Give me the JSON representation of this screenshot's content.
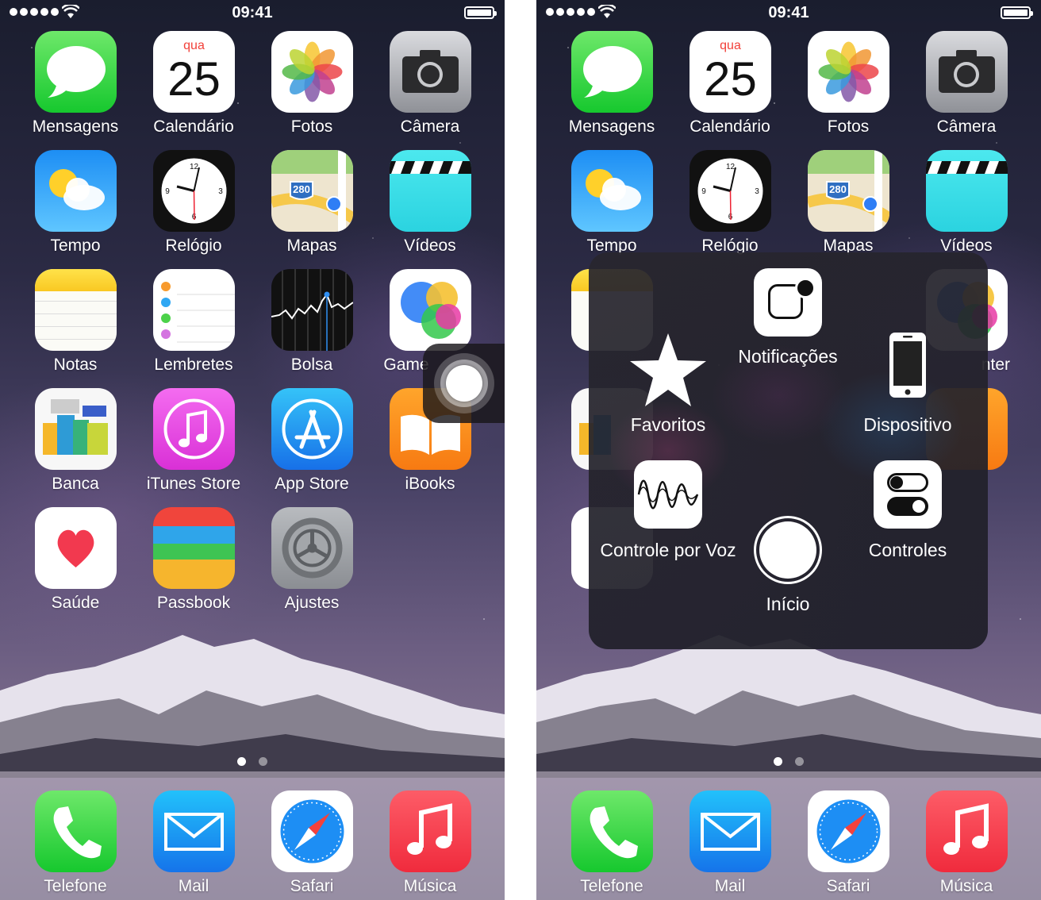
{
  "status_bar": {
    "time": "09:41"
  },
  "calendar_icon": {
    "weekday": "qua",
    "day": "25"
  },
  "maps_icon": {
    "highway": "280"
  },
  "home_apps": [
    {
      "label": "Mensagens"
    },
    {
      "label": "Calendário"
    },
    {
      "label": "Fotos"
    },
    {
      "label": "Câmera"
    },
    {
      "label": "Tempo"
    },
    {
      "label": "Relógio"
    },
    {
      "label": "Mapas"
    },
    {
      "label": "Vídeos"
    },
    {
      "label": "Notas"
    },
    {
      "label": "Lembretes"
    },
    {
      "label": "Bolsa"
    },
    {
      "label": "Game Center"
    },
    {
      "label": "Banca"
    },
    {
      "label": "iTunes Store"
    },
    {
      "label": "App Store"
    },
    {
      "label": "iBooks"
    },
    {
      "label": "Saúde"
    },
    {
      "label": "Passbook"
    },
    {
      "label": "Ajustes"
    }
  ],
  "right_partial_labels": {
    "tempo": "Tempo",
    "relogio": "Relógio",
    "mapas": "Mapas",
    "videos": "Vídeos",
    "game_center_tail": "nter"
  },
  "dock_apps": [
    {
      "label": "Telefone"
    },
    {
      "label": "Mail"
    },
    {
      "label": "Safari"
    },
    {
      "label": "Música"
    }
  ],
  "left_game_center_visible": "Game",
  "assistive_menu": {
    "notifications": "Notificações",
    "favorites": "Favoritos",
    "device": "Dispositivo",
    "voice_control": "Controle por Voz",
    "controls": "Controles",
    "home": "Início"
  },
  "page_indicator": {
    "pages": 2,
    "current": 1
  }
}
